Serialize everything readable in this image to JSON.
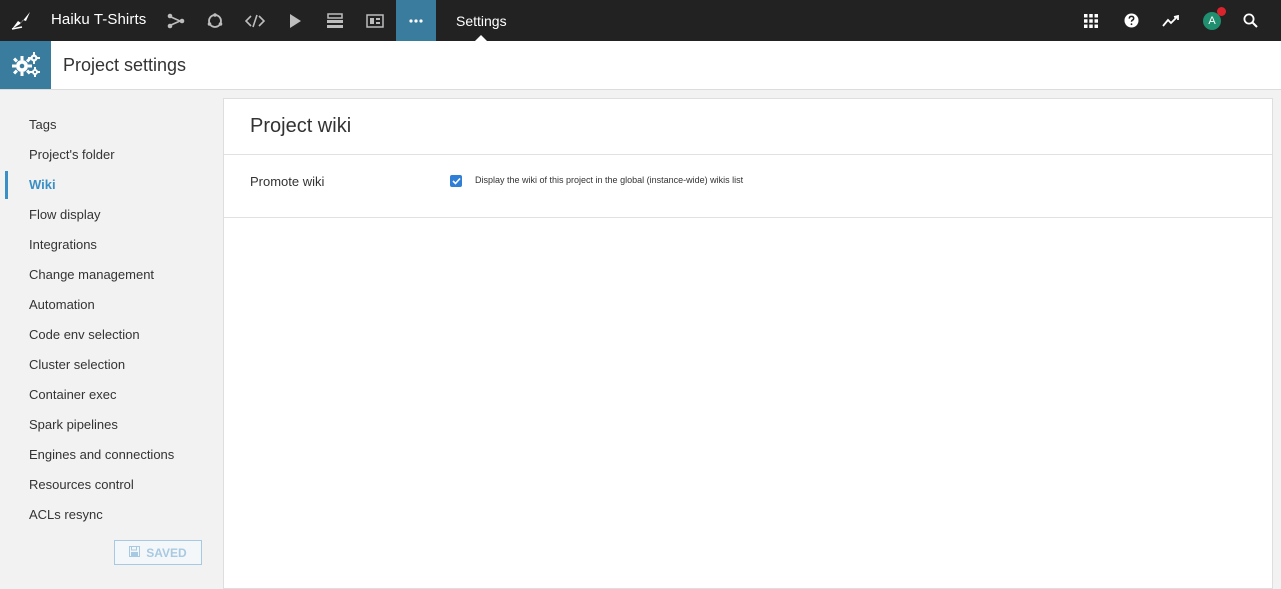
{
  "topbar": {
    "project_name": "Haiku T-Shirts",
    "section_title": "Settings",
    "icons": [
      "logo-bird-icon",
      "flow-icon",
      "recipes-icon",
      "code-icon",
      "run-icon",
      "deploy-icon",
      "dashboard-icon",
      "more-icon",
      "apps-grid-icon",
      "help-icon",
      "activity-icon",
      "avatar",
      "search-icon"
    ],
    "avatar_letter": "A"
  },
  "subheader": {
    "title": "Project settings"
  },
  "sidebar": {
    "items": [
      {
        "label": "Tags"
      },
      {
        "label": "Project's folder"
      },
      {
        "label": "Wiki",
        "active": true
      },
      {
        "label": "Flow display"
      },
      {
        "label": "Integrations"
      },
      {
        "label": "Change management"
      },
      {
        "label": "Automation"
      },
      {
        "label": "Code env selection"
      },
      {
        "label": "Cluster selection"
      },
      {
        "label": "Container exec"
      },
      {
        "label": "Spark pipelines"
      },
      {
        "label": "Engines and connections"
      },
      {
        "label": "Resources control"
      },
      {
        "label": "ACLs resync"
      }
    ],
    "saved_label": "SAVED"
  },
  "main": {
    "title": "Project wiki",
    "promote_label": "Promote wiki",
    "promote_checked": true,
    "promote_description": "Display the wiki of this project in the global (instance-wide) wikis list"
  },
  "colors": {
    "accent": "#3a7c9e",
    "active_text": "#3a90c4",
    "topbar_bg": "#222222",
    "checkbox": "#2f7fd6"
  }
}
